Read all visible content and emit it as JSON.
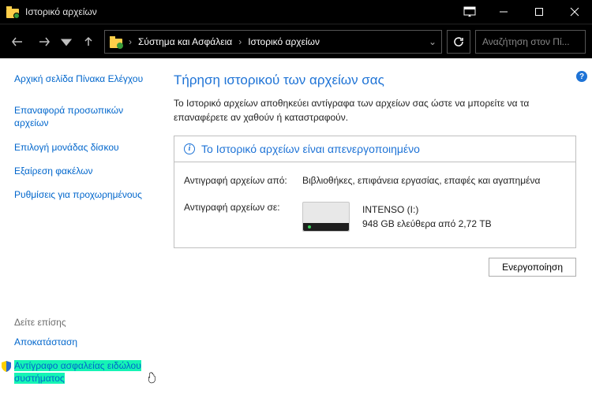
{
  "window": {
    "title": "Ιστορικό αρχείων"
  },
  "breadcrumb": {
    "parent": "Σύστημα και Ασφάλεια",
    "current": "Ιστορικό αρχείων"
  },
  "search": {
    "placeholder": "Αναζήτηση στον Πί..."
  },
  "sidebar": {
    "home": "Αρχική σελίδα Πίνακα Ελέγχου",
    "items": [
      "Επαναφορά προσωπικών αρχείων",
      "Επιλογή μονάδας δίσκου",
      "Εξαίρεση φακέλων",
      "Ρυθμίσεις για προχωρημένους"
    ],
    "see_also_h": "Δείτε επίσης",
    "see_also": [
      "Αποκατάσταση",
      "Αντίγραφο ασφαλείας ειδώλου συστήματος"
    ]
  },
  "main": {
    "title": "Τήρηση ιστορικού των αρχείων σας",
    "desc": "Το Ιστορικό αρχείων αποθηκεύει αντίγραφα των αρχείων σας ώστε να μπορείτε να τα επαναφέρετε αν χαθούν ή καταστραφούν.",
    "status": "Το Ιστορικό αρχείων είναι απενεργοποιημένο",
    "copy_from_label": "Αντιγραφή αρχείων από:",
    "copy_from_value": "Βιβλιοθήκες, επιφάνεια εργασίας, επαφές και αγαπημένα",
    "copy_to_label": "Αντιγραφή αρχείων σε:",
    "drive_name": "INTENSO (I:)",
    "drive_free": "948 GB ελεύθερα από 2,72 TB",
    "enable_btn": "Ενεργοποίηση"
  }
}
